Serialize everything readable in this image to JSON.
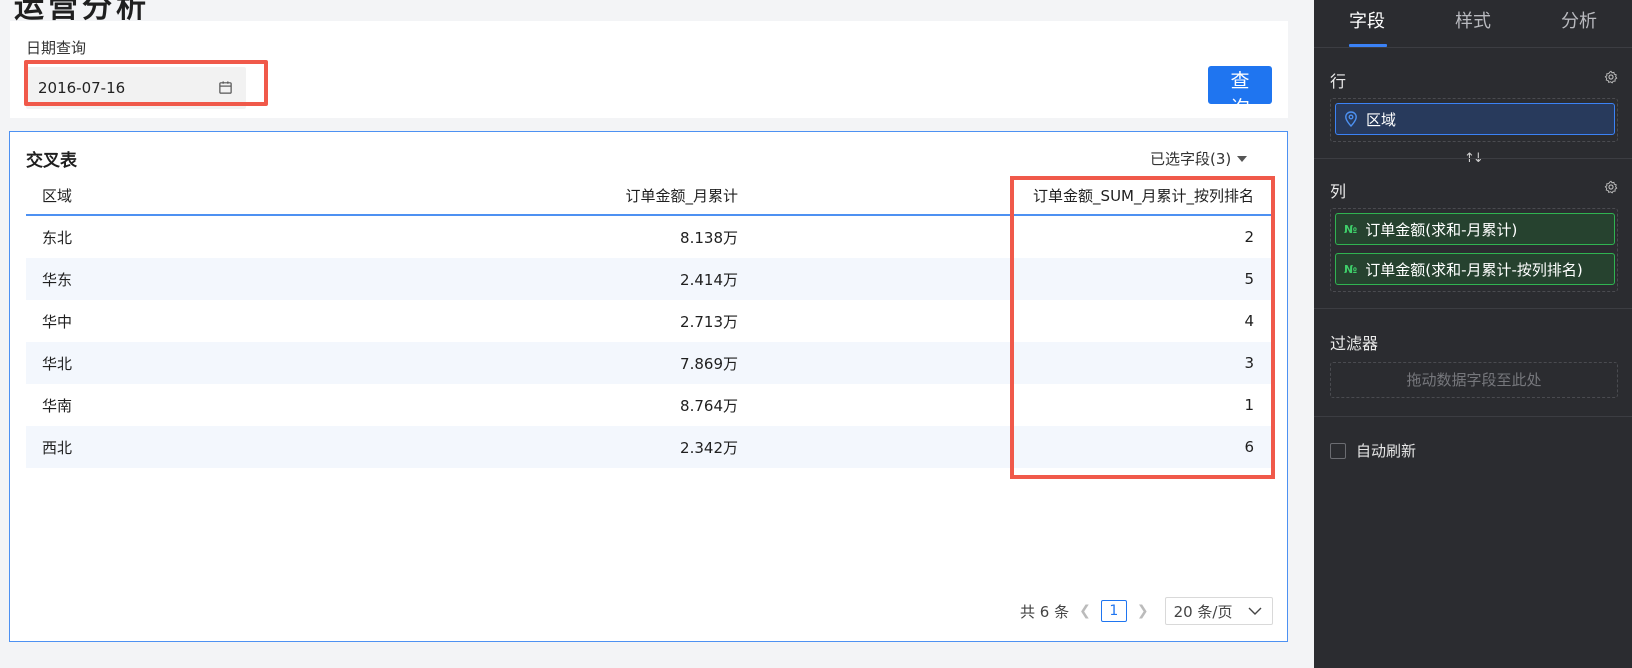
{
  "page": {
    "title": "运营分析"
  },
  "query": {
    "date_label": "日期查询",
    "date_value": "2016-07-16",
    "button_label": "查 询"
  },
  "table": {
    "title": "交叉表",
    "selected_fields": "已选字段(3)",
    "columns": [
      "区域",
      "订单金额_月累计",
      "订单金额_SUM_月累计_按列排名"
    ],
    "rows": [
      [
        "东北",
        "8.138万",
        "2"
      ],
      [
        "华东",
        "2.414万",
        "5"
      ],
      [
        "华中",
        "2.713万",
        "4"
      ],
      [
        "华北",
        "7.869万",
        "3"
      ],
      [
        "华南",
        "8.764万",
        "1"
      ],
      [
        "西北",
        "2.342万",
        "6"
      ]
    ]
  },
  "pagination": {
    "total": "共 6 条",
    "page": "1",
    "page_size": "20 条/页"
  },
  "side": {
    "tabs": [
      "字段",
      "样式",
      "分析"
    ],
    "rows_title": "行",
    "rows_chip": "区域",
    "cols_title": "列",
    "col_chips": [
      "订单金额(求和-月累计)",
      "订单金额(求和-月累计-按列排名)"
    ],
    "chip_type": "№",
    "filter_title": "过滤器",
    "filter_placeholder": "拖动数据字段至此处",
    "auto_refresh": "自动刷新"
  },
  "colors": {
    "accent": "#1f75f0",
    "highlight": "#f0594a",
    "panel": "#2b2c30"
  }
}
